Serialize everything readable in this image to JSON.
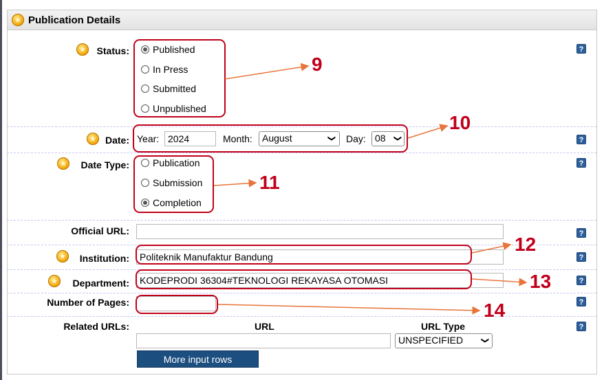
{
  "section": {
    "title": "Publication Details"
  },
  "status": {
    "label": "Status:",
    "options": [
      "Published",
      "In Press",
      "Submitted",
      "Unpublished"
    ],
    "selected": "Published"
  },
  "date": {
    "label": "Date:",
    "year_label": "Year:",
    "year_value": "2024",
    "month_label": "Month:",
    "month_value": "August",
    "day_label": "Day:",
    "day_value": "08"
  },
  "date_type": {
    "label": "Date Type:",
    "options": [
      "Publication",
      "Submission",
      "Completion"
    ],
    "selected": "Completion"
  },
  "official_url": {
    "label": "Official URL:",
    "value": ""
  },
  "institution": {
    "label": "Institution:",
    "value": "Politeknik Manufaktur Bandung"
  },
  "department": {
    "label": "Department:",
    "value": "KODEPRODI 36304#TEKNOLOGI REKAYASA OTOMASI"
  },
  "number_of_pages": {
    "label": "Number of Pages:",
    "value": ""
  },
  "related_urls": {
    "label": "Related URLs:",
    "url_header": "URL",
    "url_type_header": "URL Type",
    "url_value": "",
    "url_type_value": "UNSPECIFIED",
    "more_rows_button": "More input rows"
  },
  "help_icon_text": "?",
  "annotations": [
    "9",
    "10",
    "11",
    "12",
    "13",
    "14"
  ],
  "colors": {
    "annotation_red": "#c0001a",
    "arrow_orange": "#e8743a",
    "button_blue": "#1c4e80",
    "help_blue": "#2d5f9a"
  }
}
